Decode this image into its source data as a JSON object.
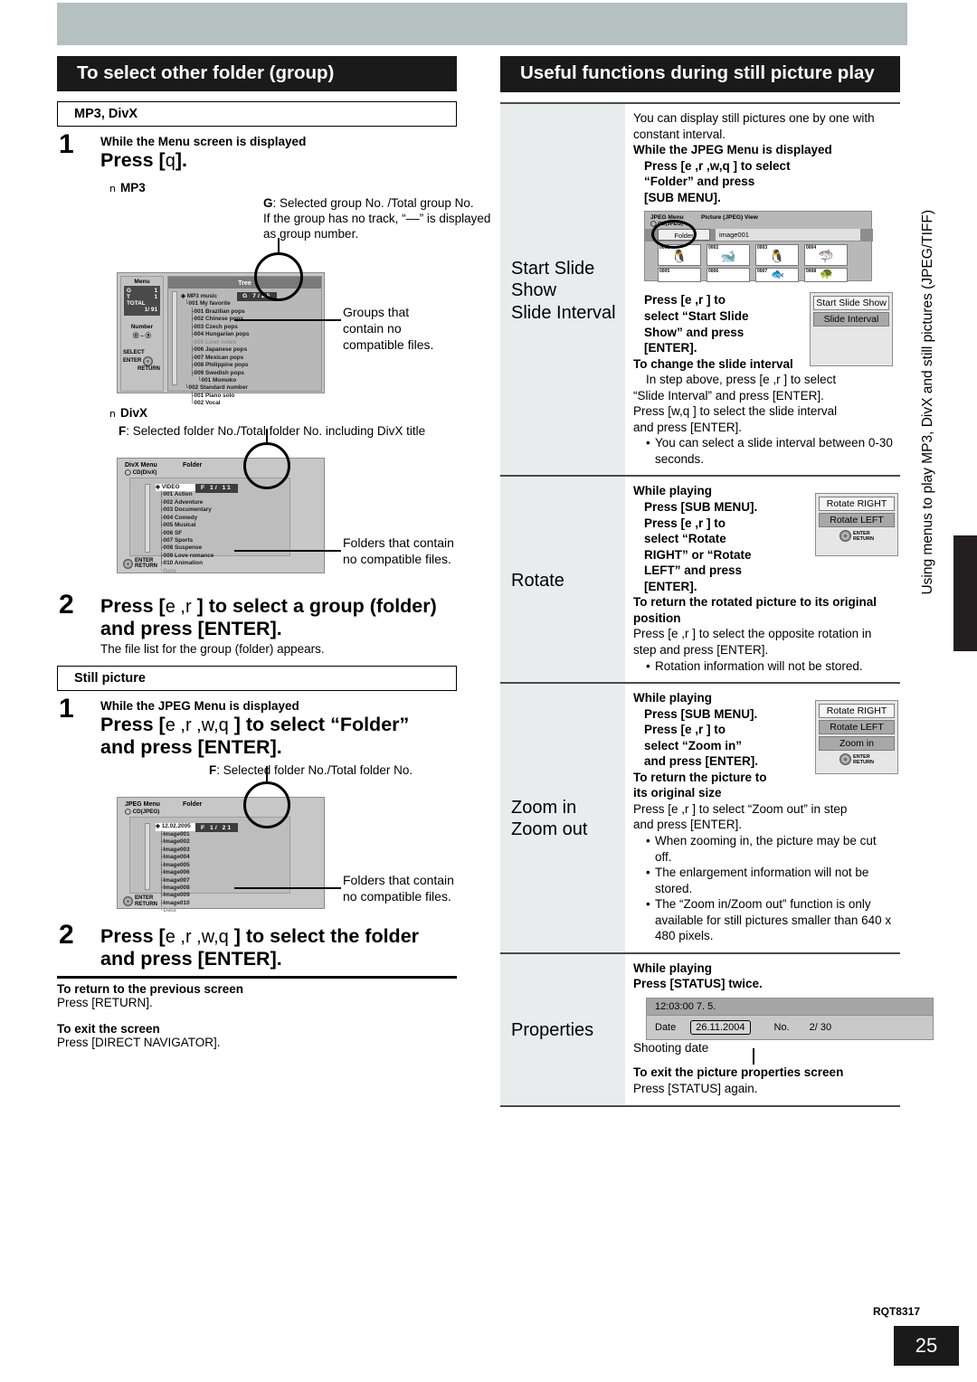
{
  "vertical_running_head": "Using menus to play MP3, DivX and still pictures (JPEG/TIFF)",
  "footer": {
    "code": "RQT8317",
    "page_number": "25"
  },
  "left_column": {
    "heading": "To select other folder (group)",
    "media_box_1": "MP3, DivX",
    "step1": {
      "number": "1",
      "pre": "While the Menu screen is displayed",
      "command": "Press [",
      "command_key": "q",
      "command_end": "].",
      "sub_label_mp3": "MP3",
      "sub_label_divx": "DivX"
    },
    "mp3_note": {
      "key": "G",
      "line1": ": Selected group No. /Total group No.",
      "line2": "If the group has no track, “––” is displayed",
      "line3": "as group number."
    },
    "mp3_screen": {
      "panel_title": "Menu",
      "g_label": "G",
      "g_value": "1",
      "t_label": "T",
      "t_value": "1",
      "total_label": "TOTAL",
      "total_value": "1/ 91",
      "number_label": "Number",
      "number_range": "⓪ – ⑨",
      "select_label": "SELECT",
      "enter_label": "ENTER",
      "return_label": "RETURN",
      "titlebar": "Tree",
      "badge": "G      7/25",
      "root": "MP3 music",
      "items": [
        "001 My favorite",
        "001 Brazilian pops",
        "002 Chinese pops",
        "003 Czech pops",
        "004 Hungarian pops",
        "005 Liner notes",
        "006 Japanese pops",
        "007 Mexican pops",
        "008 Philippine pops",
        "009 Swedish pops",
        "001 Momoko",
        "002 Standard number",
        "001 Piano solo",
        "002 Vocal"
      ],
      "callout": "Groups that contain no compatible files."
    },
    "divx_note": {
      "key": "F",
      "text": ": Selected folder No./Total folder No. including DivX title"
    },
    "divx_screen": {
      "menu_label": "DivX Menu",
      "menu_tab": "Folder",
      "disc_label": "CD(DivX)",
      "badge": "F      1/ 11",
      "root": "VIDEO",
      "items": [
        "001 Action",
        "002 Adventure",
        "003 Documentary",
        "004 Comedy",
        "005 Musical",
        "006 SF",
        "007 Sports",
        "008 Suspense",
        "009 Love romance",
        "010 Animation",
        "Data"
      ],
      "enter_label": "ENTER",
      "return_label": "RETURN",
      "callout": "Folders that contain no compatible files."
    },
    "step2": {
      "number": "2",
      "command_a": "Press [",
      "command_keys": "e ,r",
      "command_b": "] to select a group (folder)",
      "command_c": "and press [ENTER].",
      "sub": "The file list for the group (folder) appears."
    },
    "media_box_2": "Still picture",
    "step3": {
      "number": "1",
      "pre": "While the JPEG Menu is displayed",
      "command_a": "Press [",
      "command_keys": "e ,r ,w,q",
      "command_b": "] to select “Folder”",
      "command_c": "and press [ENTER]."
    },
    "jpeg_note": {
      "key": "F",
      "text": ": Selected folder No./Total folder No."
    },
    "jpeg_screen": {
      "menu_label": "JPEG Menu",
      "menu_tab": "Folder",
      "disc_label": "CD(JPEG)",
      "badge": "F      1/ 21",
      "root": "12.02.2005",
      "items": [
        "Image001",
        "Image002",
        "Image003",
        "Image004",
        "Image005",
        "Image006",
        "Image007",
        "Image008",
        "Image009",
        "Image010",
        "Data"
      ],
      "enter_label": "ENTER",
      "return_label": "RETURN",
      "callout": "Folders that contain no compatible files."
    },
    "step4": {
      "number": "2",
      "command_a": "Press [",
      "command_keys": "e ,r ,w,q",
      "command_b": "] to select the folder",
      "command_c": "and press [ENTER]."
    },
    "tips": [
      {
        "title": "To return to the previous screen",
        "body": "Press [RETURN]."
      },
      {
        "title": "To exit the screen",
        "body": "Press [DIRECT NAVIGATOR]."
      }
    ]
  },
  "right_column": {
    "heading": "Useful functions during still picture play",
    "rows": [
      {
        "label": "Start Slide Show\nSlide Interval",
        "intro": "You can display still pictures one by one with constant interval.",
        "while": "While the JPEG Menu is displayed",
        "cmd_lines": [
          "Press [e ,r ,w,q ] to select",
          "“Folder” and press",
          "[SUB MENU]."
        ],
        "screen": {
          "menu_label": "JPEG Menu",
          "view_label": "Picture (JPEG) View",
          "disc_label": "CD(JPEG)",
          "folder_btn": "Folder",
          "file_name": "image001",
          "thumb_numbers": [
            "0001",
            "0002",
            "0003",
            "0004",
            "0005",
            "0006",
            "0007",
            "0008"
          ]
        },
        "cmd2_lines": [
          "Press [e ,r ] to",
          "select “Start Slide",
          "Show” and press",
          "[ENTER]."
        ],
        "submenu": [
          "Start Slide Show",
          "Slide Interval"
        ],
        "submenu_selected": 1,
        "subhead": "To change the slide interval",
        "body": [
          "In step      above, press [e ,r  ] to select",
          "“Slide Interval” and press [ENTER].",
          "Press [w,q ] to select the slide interval",
          "and press [ENTER]."
        ],
        "dots": [
          "You can select a slide interval between 0-30 seconds."
        ]
      },
      {
        "label": "Rotate",
        "while": "While playing",
        "cmd_lines": [
          "Press [SUB MENU].",
          "Press [e ,r  ] to",
          "select “Rotate",
          "RIGHT” or “Rotate",
          "LEFT” and press",
          "[ENTER]."
        ],
        "submenu": [
          "Rotate RIGHT",
          "Rotate LEFT"
        ],
        "submenu_selected": 1,
        "dial_enter": "ENTER",
        "dial_return": "RETURN",
        "subhead": "To return the rotated picture to its original position",
        "body": [
          "Press [e ,r  ] to select the opposite rotation in",
          "step      and press [ENTER]."
        ],
        "dots": [
          "Rotation information will not be stored."
        ]
      },
      {
        "label": "Zoom in\nZoom out",
        "while": "While playing",
        "cmd_lines": [
          "Press [SUB MENU].",
          "Press [e ,r  ] to",
          "select “Zoom in”",
          "and press [ENTER]."
        ],
        "submenu": [
          "Rotate RIGHT",
          "Rotate LEFT",
          "Zoom in"
        ],
        "submenu_selected": 2,
        "dial_enter": "ENTER",
        "dial_return": "RETURN",
        "subhead": "To return the picture to its original size",
        "body": [
          "Press [e ,r  ] to select “Zoom out” in step",
          "and press [ENTER]."
        ],
        "dots": [
          "When zooming in, the picture may be cut off.",
          "The enlargement information will not be stored.",
          "The “Zoom in/Zoom out” function is only available for still pictures smaller than 640 x 480 pixels."
        ]
      },
      {
        "label": "Properties",
        "while": "While playing",
        "cmd_lines": [
          "Press [STATUS] twice."
        ],
        "properties_banner": {
          "time": "12:03:00  7. 5.",
          "date_label": "Date",
          "date_value": "26.11.2004",
          "no_label": "No.",
          "no_value": "2/  30"
        },
        "shooting_date_label": "Shooting date",
        "subhead": "To exit the picture properties screen",
        "body": [
          "Press [STATUS] again."
        ]
      }
    ]
  }
}
